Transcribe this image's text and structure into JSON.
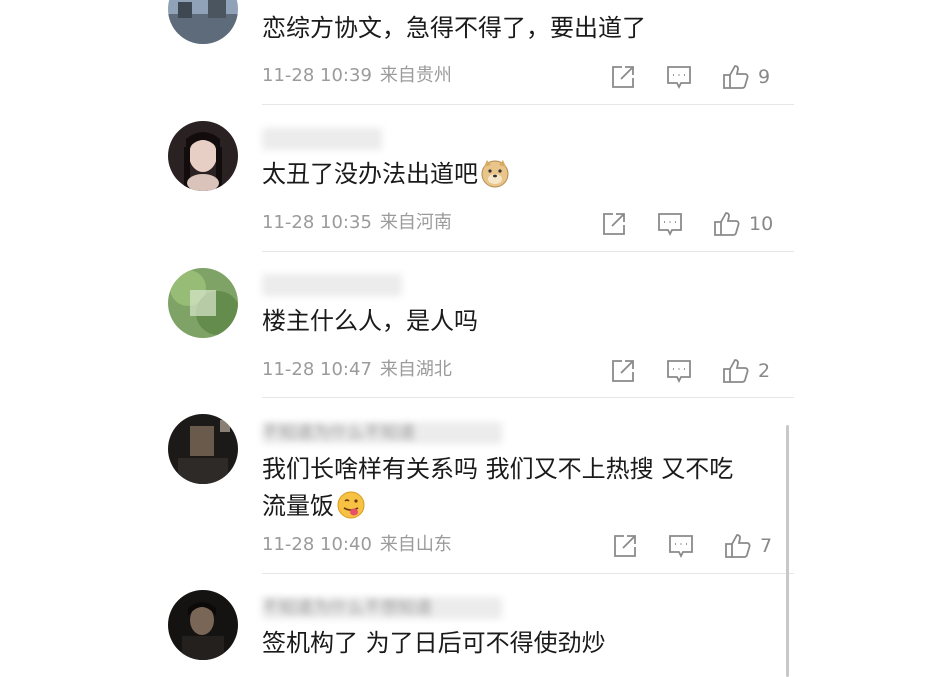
{
  "comments": [
    {
      "username": "",
      "text": "恋综方协文，急得不得了，要出道了",
      "date": "11-28 10:39",
      "location": "来自贵州",
      "likes": "9"
    },
    {
      "username": "",
      "text": "太丑了没办法出道吧",
      "date": "11-28 10:35",
      "location": "来自河南",
      "likes": "10"
    },
    {
      "username": "",
      "text": "楼主什么人，是人吗",
      "date": "11-28 10:47",
      "location": "来自湖北",
      "likes": "2"
    },
    {
      "username": "不知道为什么不知道",
      "text_line1": "我们长啥样有关系吗 我们又不上热搜 又不吃",
      "text_line2": "流量饭",
      "date": "11-28 10:40",
      "location": "来自山东",
      "likes": "7"
    },
    {
      "username": "不知道为什么不想知道",
      "text": "签机构了 为了日后可不得使劲炒"
    }
  ],
  "icons": {
    "share": "share-icon",
    "reply": "comment-icon",
    "like": "thumbs-up-icon"
  },
  "colors": {
    "meta_text": "#9b9b9b",
    "divider": "#e6e6e6"
  }
}
